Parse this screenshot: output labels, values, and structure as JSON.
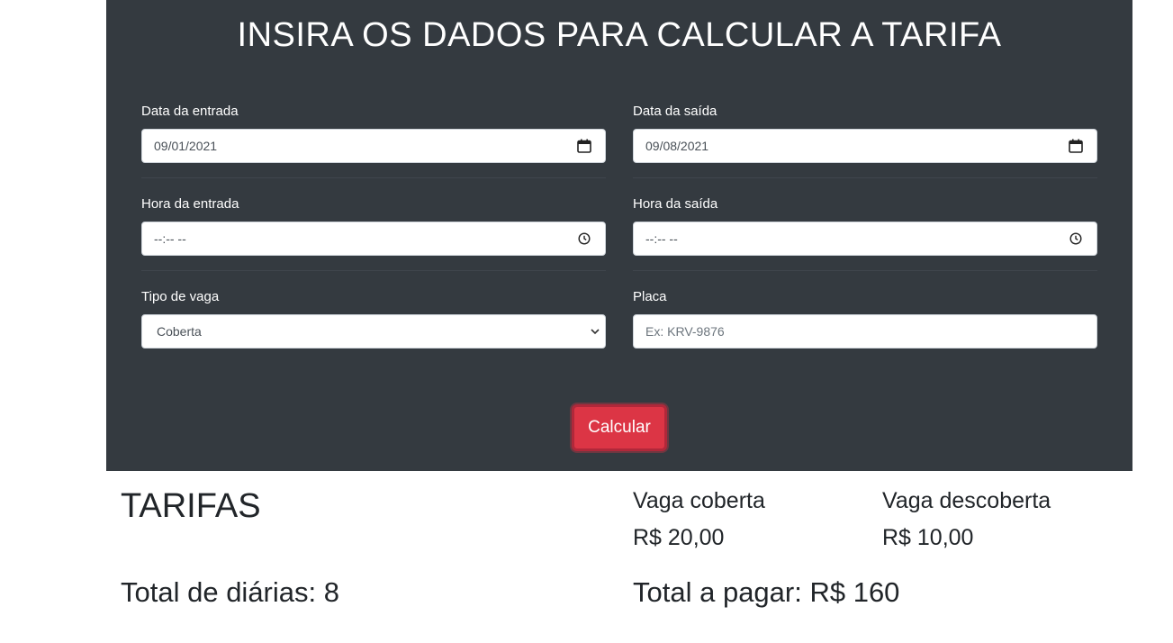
{
  "form": {
    "title": "INSIRA OS DADOS PARA CALCULAR A TARIFA",
    "entry_date": {
      "label": "Data da entrada",
      "value": "09/01/2021"
    },
    "exit_date": {
      "label": "Data da saída",
      "value": "09/08/2021"
    },
    "entry_time": {
      "label": "Hora da entrada",
      "value": "--:-- --"
    },
    "exit_time": {
      "label": "Hora da saída",
      "value": "--:-- --"
    },
    "spot_type": {
      "label": "Tipo de vaga",
      "value": "Coberta"
    },
    "plate": {
      "label": "Placa",
      "placeholder": "Ex: KRV-9876",
      "value": ""
    },
    "submit_label": "Calcular"
  },
  "rates": {
    "title": "TARIFAS",
    "covered": {
      "label": "Vaga coberta",
      "price": "R$ 20,00"
    },
    "uncovered": {
      "label": "Vaga descoberta",
      "price": "R$ 10,00"
    }
  },
  "summary": {
    "total_days": "Total de diárias: 8",
    "total_to_pay": "Total a pagar: R$ 160"
  },
  "colors": {
    "panel_bg": "#343a40",
    "button_bg": "#dc3545",
    "text_light": "#ffffff"
  }
}
